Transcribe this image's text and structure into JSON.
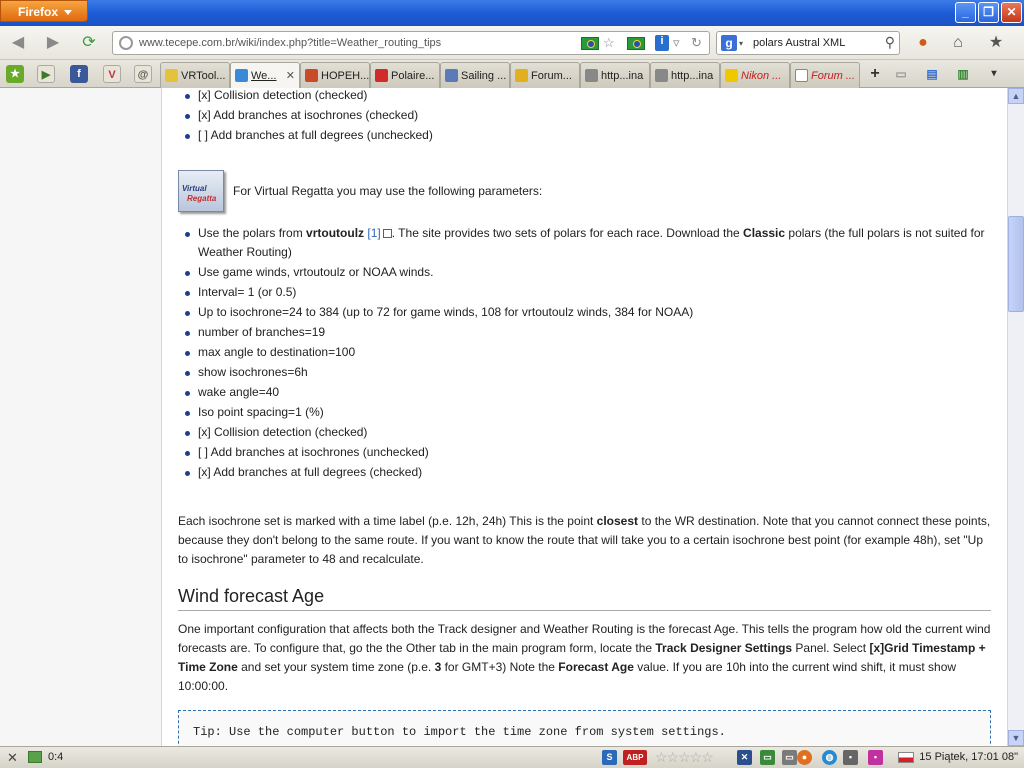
{
  "window": {
    "app_menu": "Firefox",
    "min": "_",
    "max": "❐",
    "close": "✕"
  },
  "nav": {
    "url": "www.tecepe.com.br/wiki/index.php?title=Weather_routing_tips",
    "search_value": "polars Austral XML"
  },
  "tabs": [
    {
      "label": "VRTool..."
    },
    {
      "label": "We..."
    },
    {
      "label": "HOPEH..."
    },
    {
      "label": "Polaire..."
    },
    {
      "label": "Sailing ..."
    },
    {
      "label": "Forum..."
    },
    {
      "label": "http...ina"
    },
    {
      "label": "http...ina"
    },
    {
      "label": "Nikon ..."
    },
    {
      "label": "Forum ..."
    }
  ],
  "content": {
    "list1": [
      "[x] Collision detection (checked)",
      "[x] Add branches at isochrones (checked)",
      "[ ] Add branches at full degrees (unchecked)"
    ],
    "vr_logo_top": "Virtual",
    "vr_logo_bottom": "Regatta",
    "vr_intro": "For Virtual Regatta you may use the following parameters:",
    "polars_item": {
      "pre": "Use the polars from ",
      "bold": "vrtoutoulz",
      "link": "[1]",
      "mid": ". The site provides two sets of polars for each race. Download the ",
      "bold2": "Classic",
      "post": " polars (the full polars is not suited for Weather Routing)"
    },
    "list2": [
      "Use game winds, vrtoutoulz or NOAA winds.",
      "Interval= 1 (or 0.5)",
      "Up to isochrone=24 to 384 (up to 72 for game winds, 108 for vrtoutoulz winds, 384 for NOAA)",
      "number of branches=19",
      "max angle to destination=100",
      "show isochrones=6h",
      "wake angle=40",
      "Iso point spacing=1 (%)",
      "[x] Collision detection (checked)",
      "[ ] Add branches at isochrones (unchecked)",
      "[x] Add branches at full degrees (checked)"
    ],
    "para1": {
      "pre": "Each isochrone set is marked with a time label (p.e. 12h, 24h) This is the point ",
      "bold": "closest",
      "post": " to the WR destination. Note that you cannot connect these points, because they don't belong to the same route. If you want to know the route that will take you to a certain isochrone best point (for example 48h), set \"Up to isochrone\" parameter to 48 and recalculate."
    },
    "section_title": "Wind forecast Age",
    "para2": {
      "a": "One important configuration that affects both the Track designer and Weather Routing is the forecast Age. This tells the program how old the current wind forecasts are. To configure that, go the the Other tab in the main program form, locate the ",
      "b1": "Track Designer Settings",
      "c": " Panel. Select ",
      "b2": "[x]Grid Timestamp + Time Zone",
      "d": " and set your system time zone (p.e. ",
      "b3": "3",
      "e": " for GMT+3) Note the ",
      "b4": "Forecast Age",
      "f": " value. If you are 10h into the current wind shift, it must show 10:00:00."
    },
    "tip": "Tip: Use the computer button to import the time zone from system settings."
  },
  "status": {
    "close": "✕",
    "count": "0:4",
    "abp": "ABP",
    "clock": "15 Piątek, 17:01 08\""
  }
}
